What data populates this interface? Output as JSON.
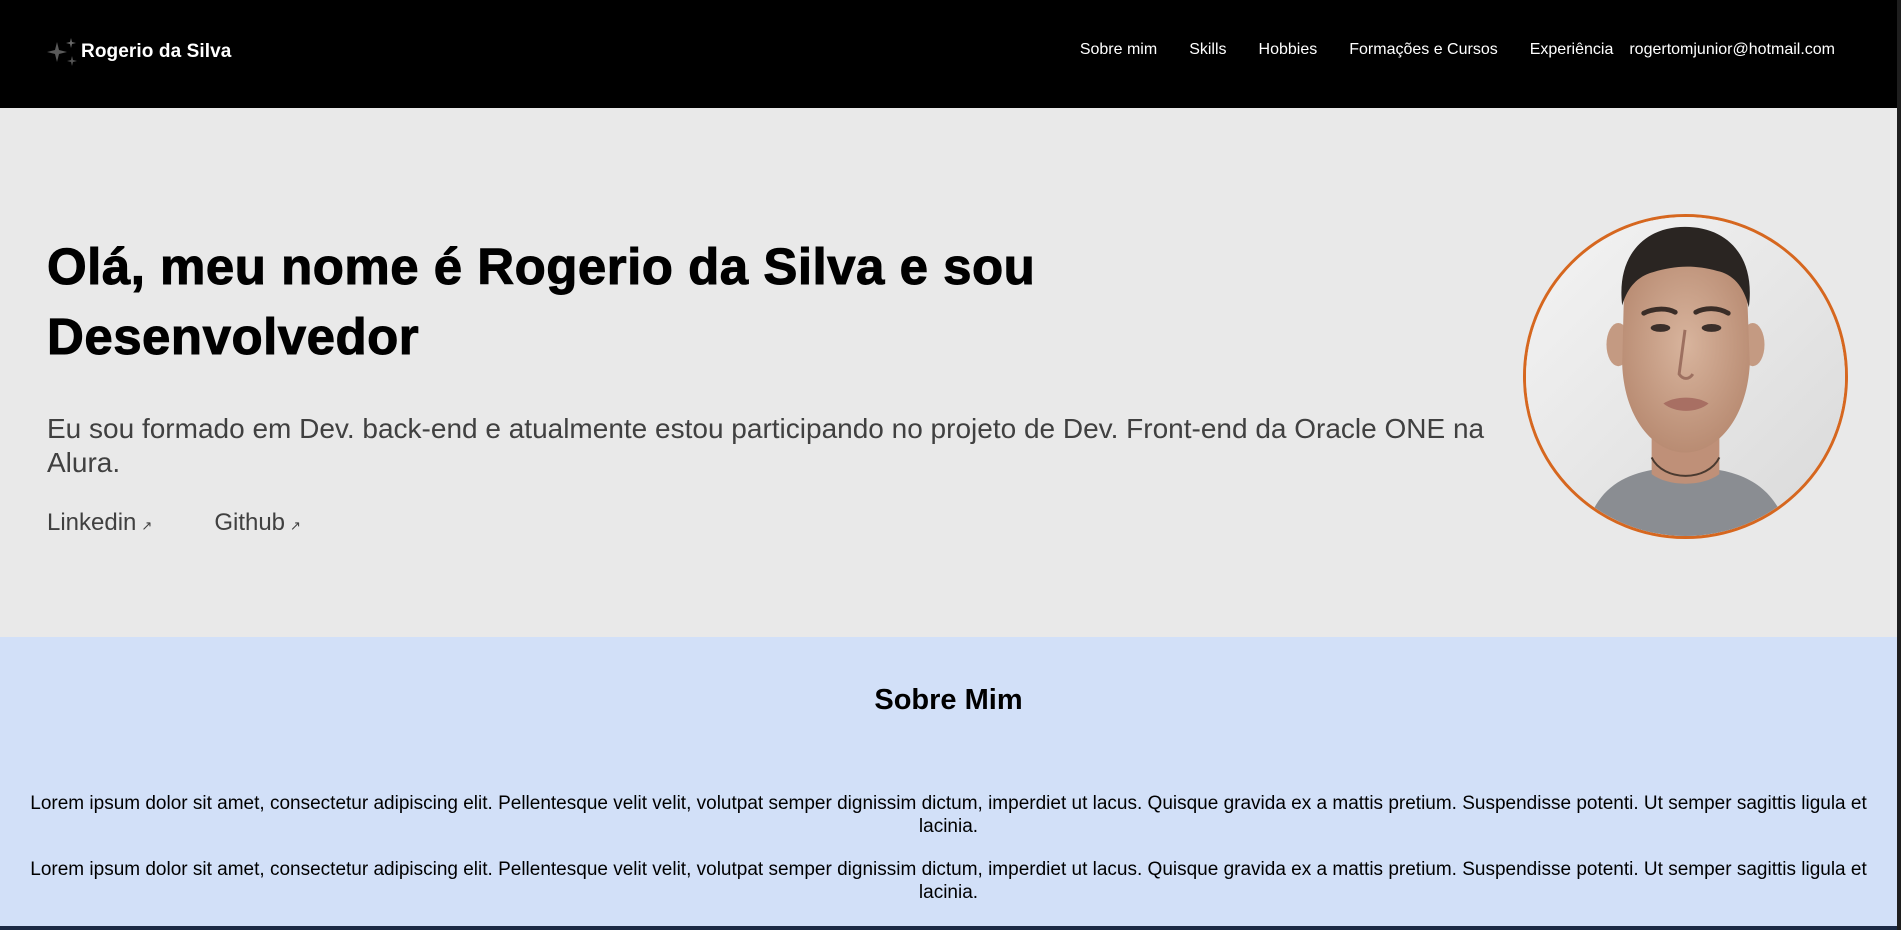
{
  "header": {
    "brand_name": "Rogerio da Silva",
    "brand_icon": "sparkle-icon",
    "nav": [
      {
        "label": "Sobre mim"
      },
      {
        "label": "Skills"
      },
      {
        "label": "Hobbies"
      },
      {
        "label": "Formações e Cursos"
      },
      {
        "label": "Experiência"
      }
    ],
    "email": "rogertomjunior@hotmail.com"
  },
  "hero": {
    "title_line1": "Olá, meu nome é Rogerio da Silva e sou",
    "title_line2": "Desenvolvedor",
    "description": "Eu sou formado em Dev. back-end e atualmente estou participando no projeto de Dev. Front-end da Oracle ONE na Alura.",
    "links": [
      {
        "label": "Linkedin",
        "icon": "external-link-arrow-icon"
      },
      {
        "label": "Github",
        "icon": "external-link-arrow-icon"
      }
    ],
    "avatar_border_color": "#d6671f"
  },
  "about": {
    "title": "Sobre Mim",
    "paragraphs": [
      "Lorem ipsum dolor sit amet, consectetur adipiscing elit. Pellentesque velit velit, volutpat semper dignissim dictum, imperdiet ut lacus. Quisque gravida ex a mattis pretium. Suspendisse potenti. Ut semper sagittis ligula et lacinia.",
      "Lorem ipsum dolor sit amet, consectetur adipiscing elit. Pellentesque velit velit, volutpat semper dignissim dictum, imperdiet ut lacus. Quisque gravida ex a mattis pretium. Suspendisse potenti. Ut semper sagittis ligula et lacinia."
    ]
  },
  "colors": {
    "header_bg": "#000000",
    "hero_bg": "#e9e9e9",
    "about_bg": "#d2e0f8",
    "accent": "#d6671f"
  }
}
